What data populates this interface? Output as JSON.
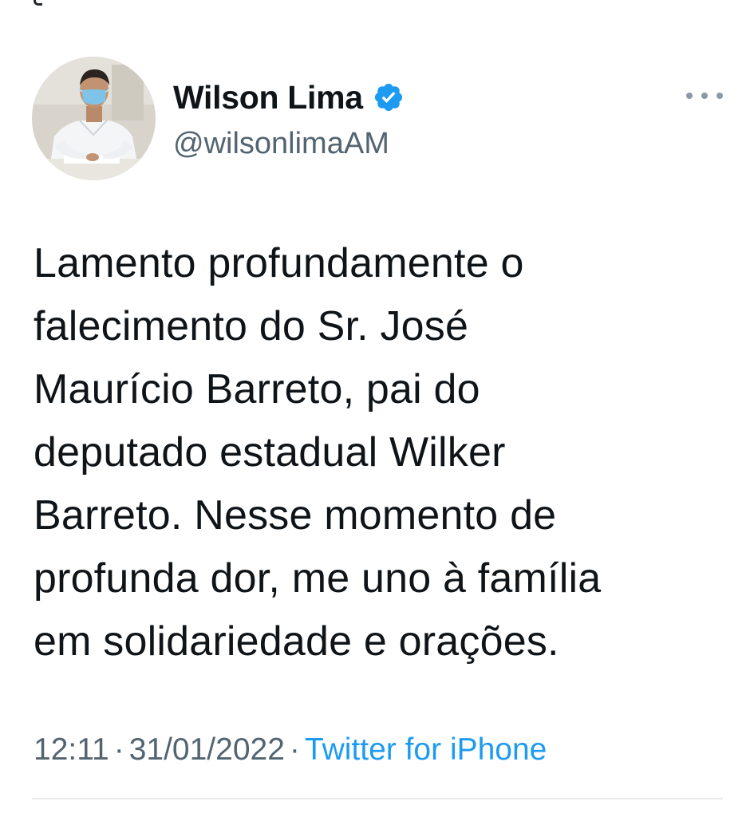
{
  "tweet": {
    "author": {
      "display_name": "Wilson Lima",
      "handle": "@wilsonlimaAM",
      "verified": true,
      "avatar_icon": "profile-photo"
    },
    "more_icon": "more-options-icon",
    "text": "Lamento profundamente o\nfalecimento do Sr. José\nMaurício Barreto, pai do\ndeputado estadual Wilker\nBarreto. Nesse momento de\nprofunda dor, me uno à família\nem solidariedade e orações.",
    "time": "12:11",
    "date": "31/01/2022",
    "separator": "·",
    "source": "Twitter for iPhone"
  },
  "colors": {
    "text": "#0f1419",
    "secondary": "#536471",
    "link": "#1d9bf0",
    "verified": "#1d9bf0",
    "divider": "#e7e9ea"
  }
}
